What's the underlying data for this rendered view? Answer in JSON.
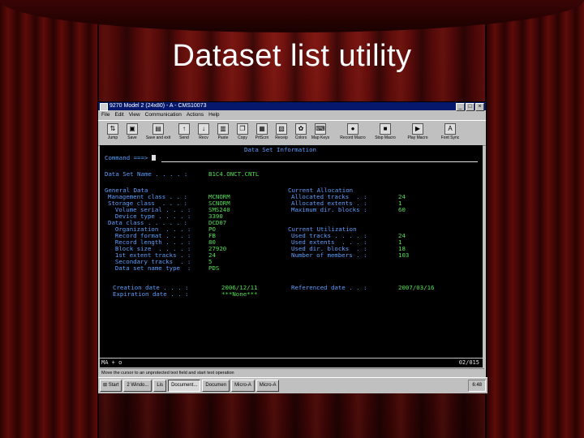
{
  "slide_title": "Dataset list utility",
  "window": {
    "title": "9270 Model 2 (24x80) - A - CMS10073",
    "menu": [
      "File",
      "Edit",
      "View",
      "Communication",
      "Actions",
      "Help"
    ],
    "toolbar": [
      "Jump",
      "Save",
      "Save and exit",
      "Send",
      "Recv",
      "Paste",
      "Copy",
      "PrtScrn",
      "Receip",
      "Colors",
      "Map Keys",
      "Record Macro",
      "Stop Macro",
      "Play Macro",
      "Font Sync"
    ]
  },
  "terminal": {
    "screen_title": "Data Set Information",
    "command_label": "Command ===>",
    "dataset_name_label": "Data Set Name . . . . :",
    "dataset_name": "B1C4.ONCT.CNTL",
    "general_header": "General Data",
    "general": [
      {
        "label": "Management class . . :",
        "value": "MCNORM"
      },
      {
        "label": "Storage class  . . . :",
        "value": "SCNORM"
      },
      {
        "label": "  Volume serial . . . :",
        "value": "SMS240"
      },
      {
        "label": "  Device type . . . . :",
        "value": "3390"
      },
      {
        "label": "Data class . . . . . :",
        "value": "DCD07"
      },
      {
        "label": "  Organization  . . . :",
        "value": "PO"
      },
      {
        "label": "  Record format . . . :",
        "value": "FB"
      },
      {
        "label": "  Record length . . . :",
        "value": "80"
      },
      {
        "label": "  Block size  . . . . :",
        "value": "27920"
      },
      {
        "label": "  1st extent tracks . :",
        "value": "24"
      },
      {
        "label": "  Secondary tracks  . :",
        "value": "5"
      },
      {
        "label": "  Data set name type  :",
        "value": "PDS"
      }
    ],
    "allocation_header": "Current Allocation",
    "allocation": [
      {
        "label": "Allocated tracks  . :",
        "value": "24"
      },
      {
        "label": "Allocated extents . :",
        "value": "1"
      },
      {
        "label": "Maximum dir. blocks :",
        "value": "60"
      }
    ],
    "utilization_header": "Current Utilization",
    "utilization": [
      {
        "label": "Used tracks . . . . :",
        "value": "24"
      },
      {
        "label": "Used extents  . . . :",
        "value": "1"
      },
      {
        "label": "Used dir. blocks  . :",
        "value": "18"
      },
      {
        "label": "Number of members . :",
        "value": "103"
      }
    ],
    "creation_label": "Creation date . . . :",
    "creation_value": "2006/12/11",
    "referenced_label": "Referenced date . . :",
    "referenced_value": "2007/03/16",
    "expiration_label": "Expiration date . . :",
    "expiration_value": "***None***"
  },
  "oia": {
    "left": "MA   +   o",
    "right": "02/015"
  },
  "statusbar": "Move the cursor to an unprotected text field and start text operation",
  "taskbar": {
    "start": "Start",
    "tasks": [
      "2 Windo...",
      "Lis",
      "Document...",
      "Documen",
      "Micro-A",
      "Micro-A"
    ],
    "tray": "6:48"
  },
  "colors": {
    "title_bar": "#06186b",
    "terminal_bg": "#000000",
    "field_text": "#4ee04e",
    "label_text": "#5aa0ff"
  }
}
